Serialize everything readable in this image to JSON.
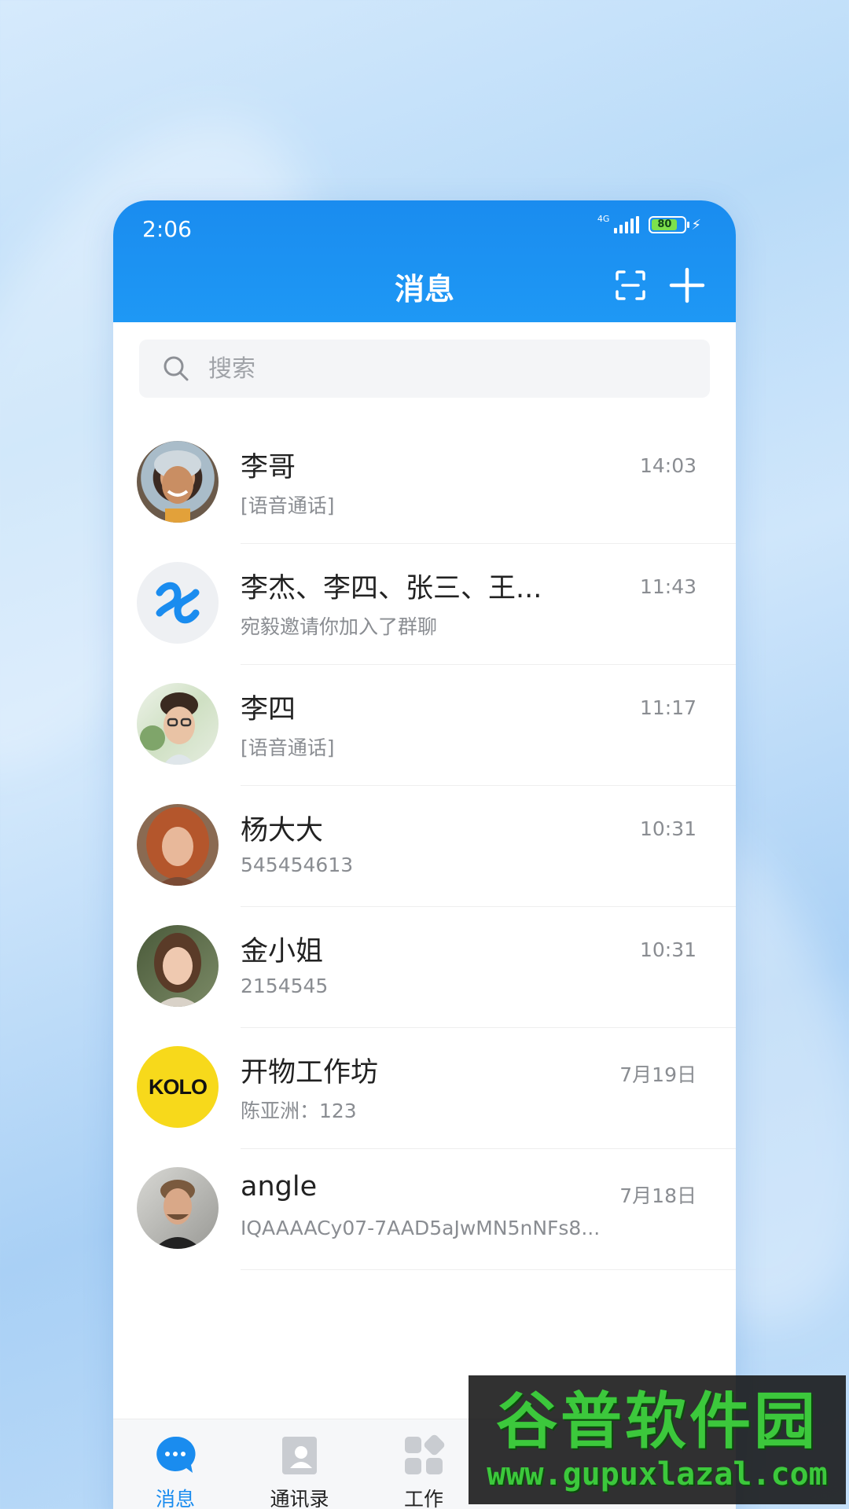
{
  "status_bar": {
    "time": "2:06",
    "network": "4G",
    "battery": "80"
  },
  "header": {
    "title": "消息"
  },
  "search": {
    "placeholder": "搜索"
  },
  "conversations": [
    {
      "name": "李哥",
      "preview": "[语音通话]",
      "time": "14:03"
    },
    {
      "name": "李杰、李四、张三、王...",
      "preview": "宛毅邀请你加入了群聊",
      "time": "11:43"
    },
    {
      "name": "李四",
      "preview": "[语音通话]",
      "time": "11:17"
    },
    {
      "name": "杨大大",
      "preview": "545454613",
      "time": "10:31"
    },
    {
      "name": "金小姐",
      "preview": "2154545",
      "time": "10:31"
    },
    {
      "name": "开物工作坊",
      "preview": "陈亚洲：123",
      "time": "7月19日",
      "avatar_text": "KOLO"
    },
    {
      "name": "angle",
      "preview": "IQAAAACy07-7AAD5aJwMN5nNFs8...",
      "time": "7月18日"
    }
  ],
  "tabs": [
    {
      "label": "消息",
      "icon": "chat-icon",
      "active": true
    },
    {
      "label": "通讯录",
      "icon": "contacts-icon",
      "active": false
    },
    {
      "label": "工作",
      "icon": "apps-grid-icon",
      "active": false
    }
  ],
  "watermark": {
    "title": "谷普软件园",
    "url": "www.gupuxlazal.com"
  },
  "colors": {
    "accent": "#1a8cef",
    "watermark_green": "#3cc83c"
  }
}
